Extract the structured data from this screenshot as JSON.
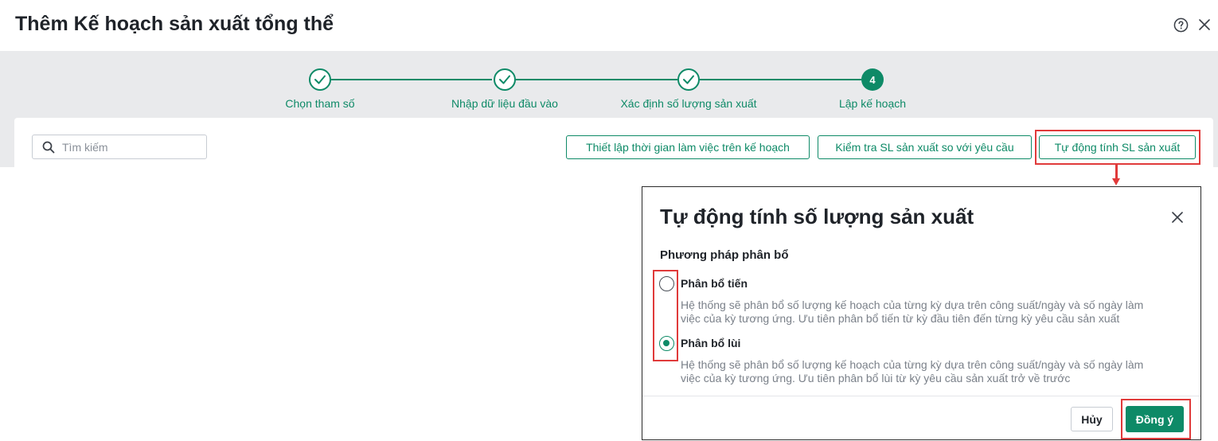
{
  "window": {
    "title": "Thêm Kế hoạch sản xuất tổng thể",
    "help_icon": "help-circle-icon",
    "close_icon": "close-icon"
  },
  "stepper": {
    "steps": [
      {
        "label": "Chọn tham số",
        "status": "done"
      },
      {
        "label": "Nhập dữ liệu đầu vào",
        "status": "done"
      },
      {
        "label": "Xác định số lượng sản xuất",
        "status": "done"
      },
      {
        "label": "Lập kế hoạch",
        "status": "active",
        "number": "4"
      }
    ]
  },
  "toolbar": {
    "search_placeholder": "Tìm kiếm",
    "btn_working_time": "Thiết lập thời gian làm việc trên kế hoạch",
    "btn_check_quantity": "Kiểm tra SL sản xuất so với yêu cầu",
    "btn_auto_calc": "Tự động tính SL sản xuất"
  },
  "dialog": {
    "title": "Tự động tính số lượng sản xuất",
    "section_label": "Phương pháp phân bổ",
    "options": [
      {
        "label": "Phân bổ tiến",
        "checked": false,
        "desc_line1": "Hệ thống sẽ phân bổ số lượng kế hoạch của từng kỳ dựa trên công suất/ngày và số ngày làm",
        "desc_line2": "việc của kỳ tương ứng. Ưu tiên phân bổ tiến từ kỳ đầu tiên đến từng kỳ yêu cầu sản xuất"
      },
      {
        "label": "Phân bổ lùi",
        "checked": true,
        "desc_line1": "Hệ thống sẽ phân bổ số lượng kế hoạch của từng kỳ dựa trên công suất/ngày và số ngày làm",
        "desc_line2": "việc của kỳ tương ứng. Ưu tiên phân bổ lùi từ kỳ yêu cầu sản xuất trở về trước"
      }
    ],
    "cancel_label": "Hủy",
    "ok_label": "Đồng ý"
  },
  "colors": {
    "accent": "#0e8a67",
    "highlight": "#e03a3a",
    "band": "#e9eaec"
  }
}
